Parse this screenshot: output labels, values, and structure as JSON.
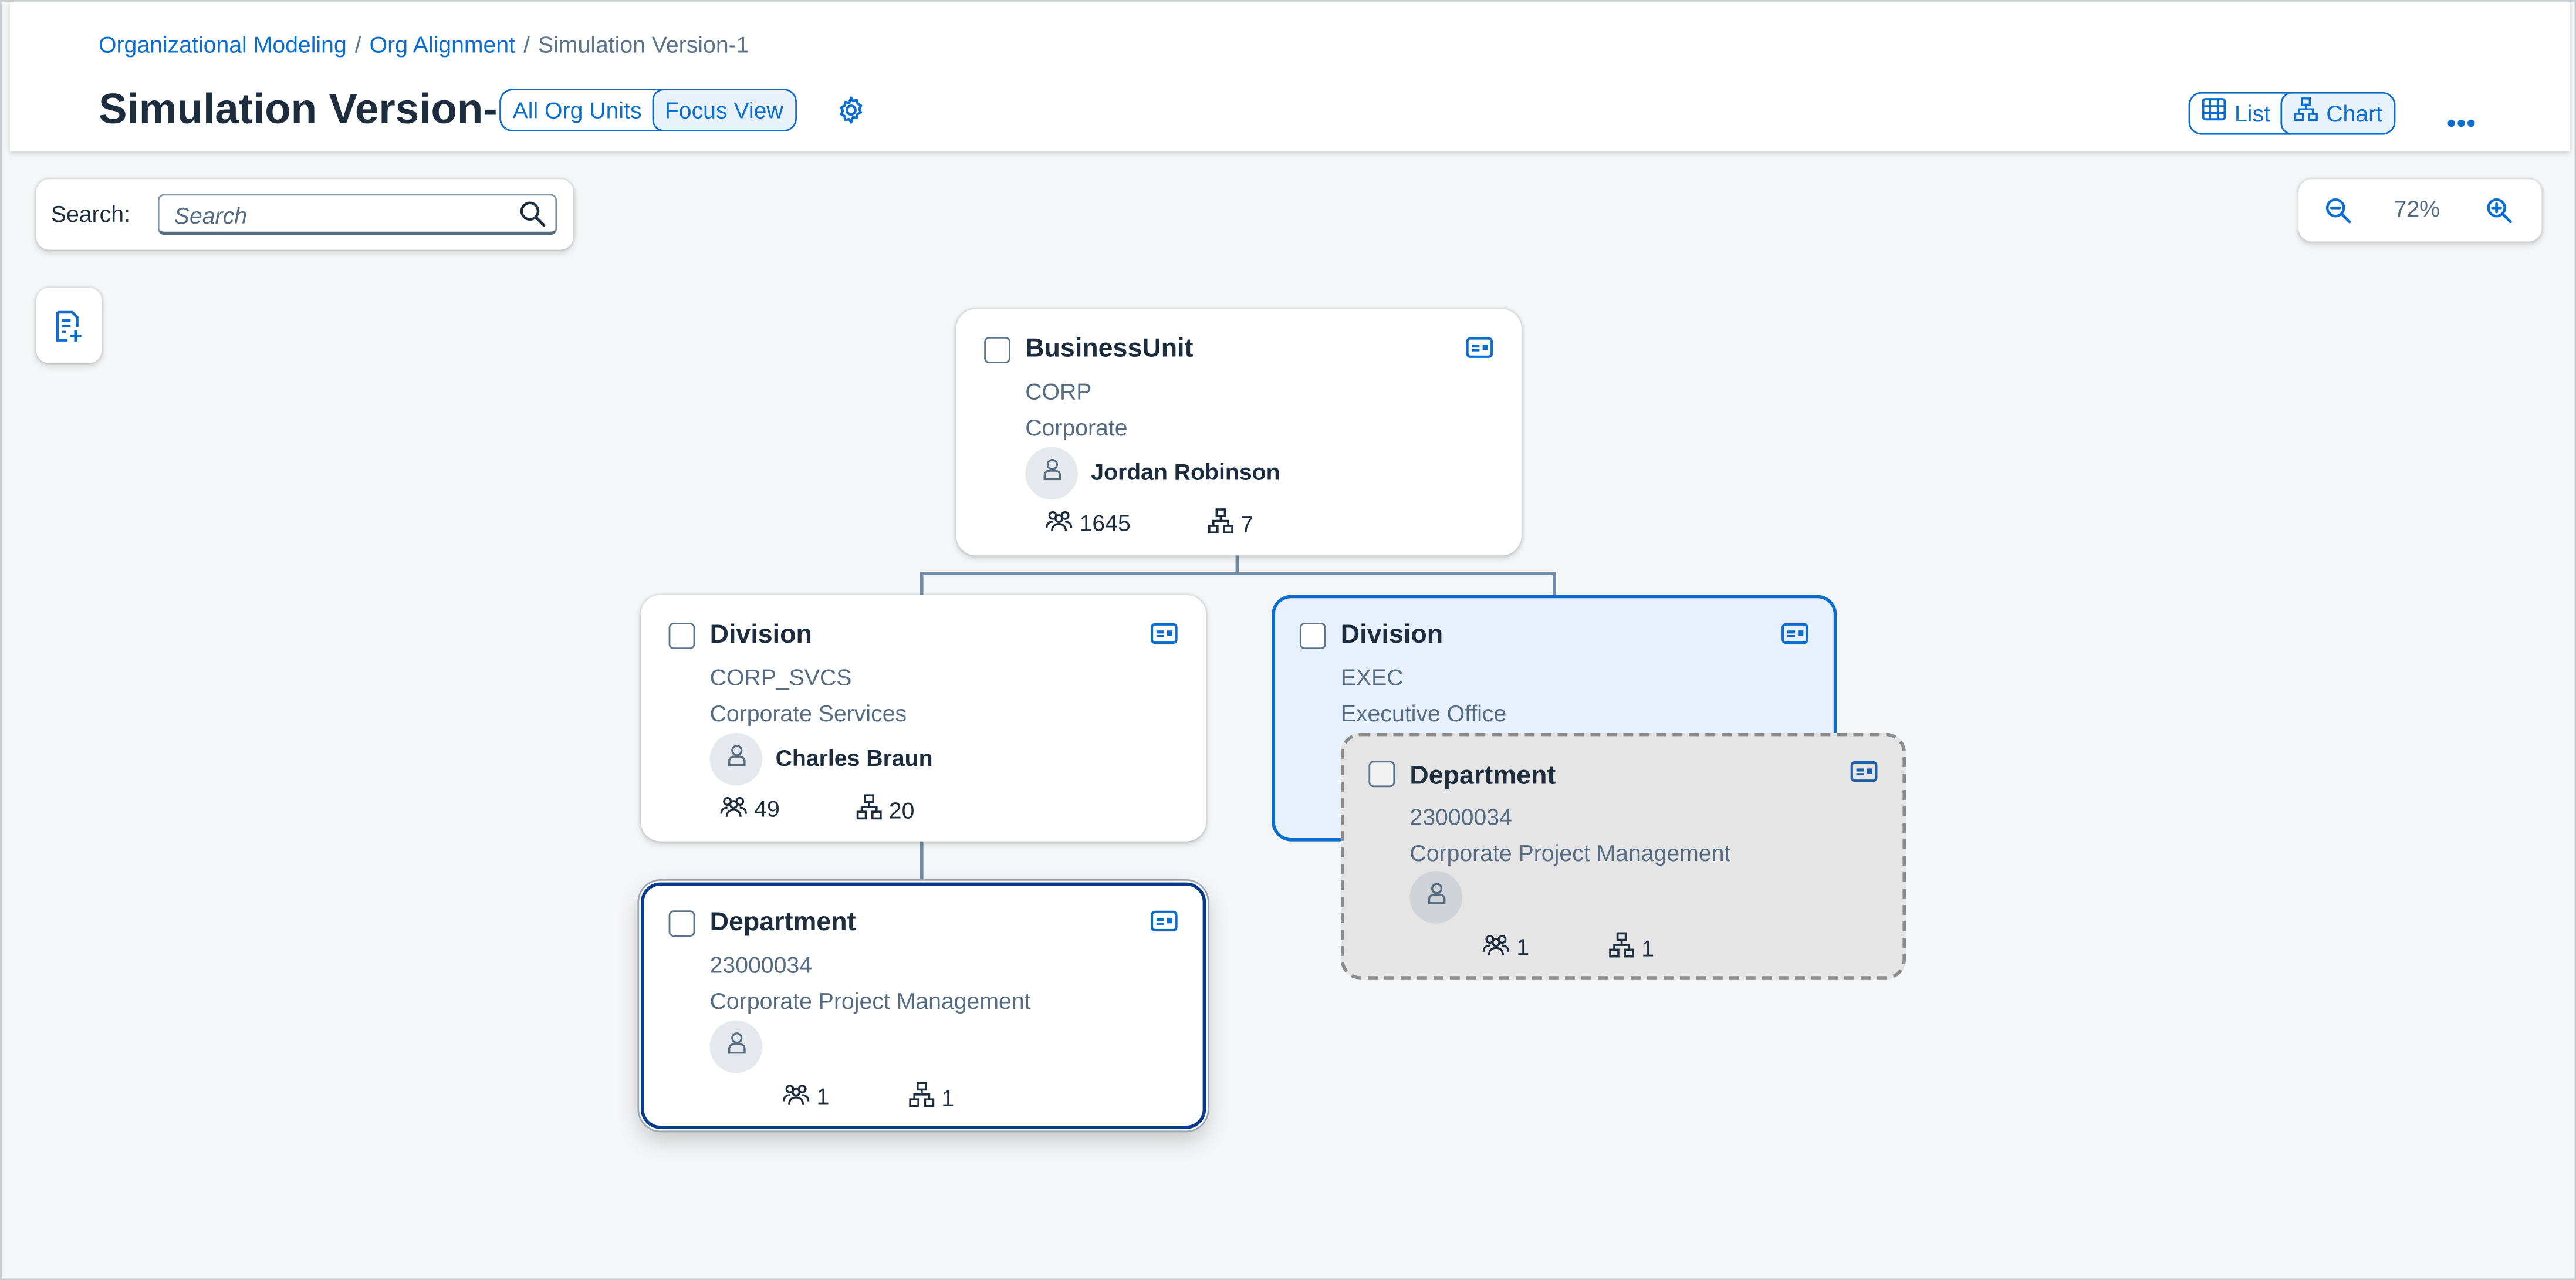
{
  "breadcrumb": {
    "item1": "Organizational Modeling",
    "item2": "Org Alignment",
    "current": "Simulation Version-1",
    "separator": "/"
  },
  "page_title": "Simulation Version-1",
  "view_toggle": {
    "all_org_units": "All Org Units",
    "focus_view": "Focus View",
    "selected": "Focus View"
  },
  "layout_toggle": {
    "list": "List",
    "chart": "Chart",
    "selected": "Chart"
  },
  "search": {
    "label": "Search:",
    "placeholder": "Search"
  },
  "zoom": {
    "value": "72%"
  },
  "colors": {
    "accent": "#0a6ed1",
    "selected_fill": "#e8f1fb",
    "drag_fill": "#e5e5e5",
    "title": "#1d2d3e"
  },
  "icons": [
    "settings-gear-icon",
    "table-icon",
    "org-chart-icon",
    "more-icon",
    "search-icon",
    "zoom-out-icon",
    "zoom-in-icon",
    "add-document-icon",
    "business-card-icon",
    "person-icon",
    "employees-icon",
    "hierarchy-icon"
  ],
  "cards": {
    "bu": {
      "type": "BusinessUnit",
      "code": "CORP",
      "name": "Corporate",
      "person": "Jordan Robinson",
      "employees": "1645",
      "units": "7"
    },
    "div1": {
      "type": "Division",
      "code": "CORP_SVCS",
      "name": "Corporate Services",
      "person": "Charles Braun",
      "employees": "49",
      "units": "20"
    },
    "div2": {
      "type": "Division",
      "code": "EXEC",
      "name": "Executive Office"
    },
    "dept1": {
      "type": "Department",
      "code": "23000034",
      "name": "Corporate Project Management",
      "employees": "1",
      "units": "1"
    },
    "dept_drag": {
      "type": "Department",
      "code": "23000034",
      "name": "Corporate Project Management",
      "employees": "1",
      "units": "1"
    }
  }
}
